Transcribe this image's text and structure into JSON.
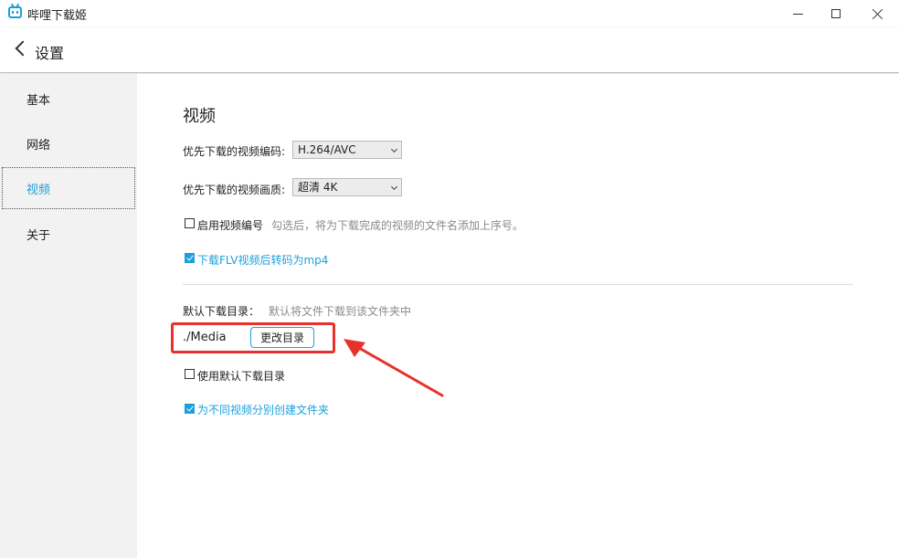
{
  "window": {
    "title": "哔哩下载姬"
  },
  "header": {
    "title": "设置"
  },
  "sidebar": {
    "items": [
      {
        "label": "基本",
        "active": false
      },
      {
        "label": "网络",
        "active": false
      },
      {
        "label": "视频",
        "active": true
      },
      {
        "label": "关于",
        "active": false
      }
    ]
  },
  "main": {
    "section_title": "视频",
    "codec": {
      "label": "优先下载的视频编码:",
      "value": "H.264/AVC"
    },
    "quality": {
      "label": "优先下载的视频画质:",
      "value": "超清 4K"
    },
    "numbering": {
      "label": "启用视频编号",
      "checked": false,
      "hint": "勾选后，将为下载完成的视频的文件名添加上序号。"
    },
    "flv_convert": {
      "label": "下载FLV视频后转码为mp4",
      "checked": true
    },
    "download_dir": {
      "label": "默认下载目录：",
      "hint": "默认将文件下载到该文件夹中",
      "path": "./Media",
      "change_button": "更改目录"
    },
    "use_default_dir": {
      "label": "使用默认下载目录",
      "checked": false
    },
    "separate_folders": {
      "label": "为不同视频分别创建文件夹",
      "checked": true
    }
  },
  "colors": {
    "accent": "#1ba0dc",
    "annotation": "#e8312c",
    "sidebar_bg": "#f2f2f2"
  }
}
